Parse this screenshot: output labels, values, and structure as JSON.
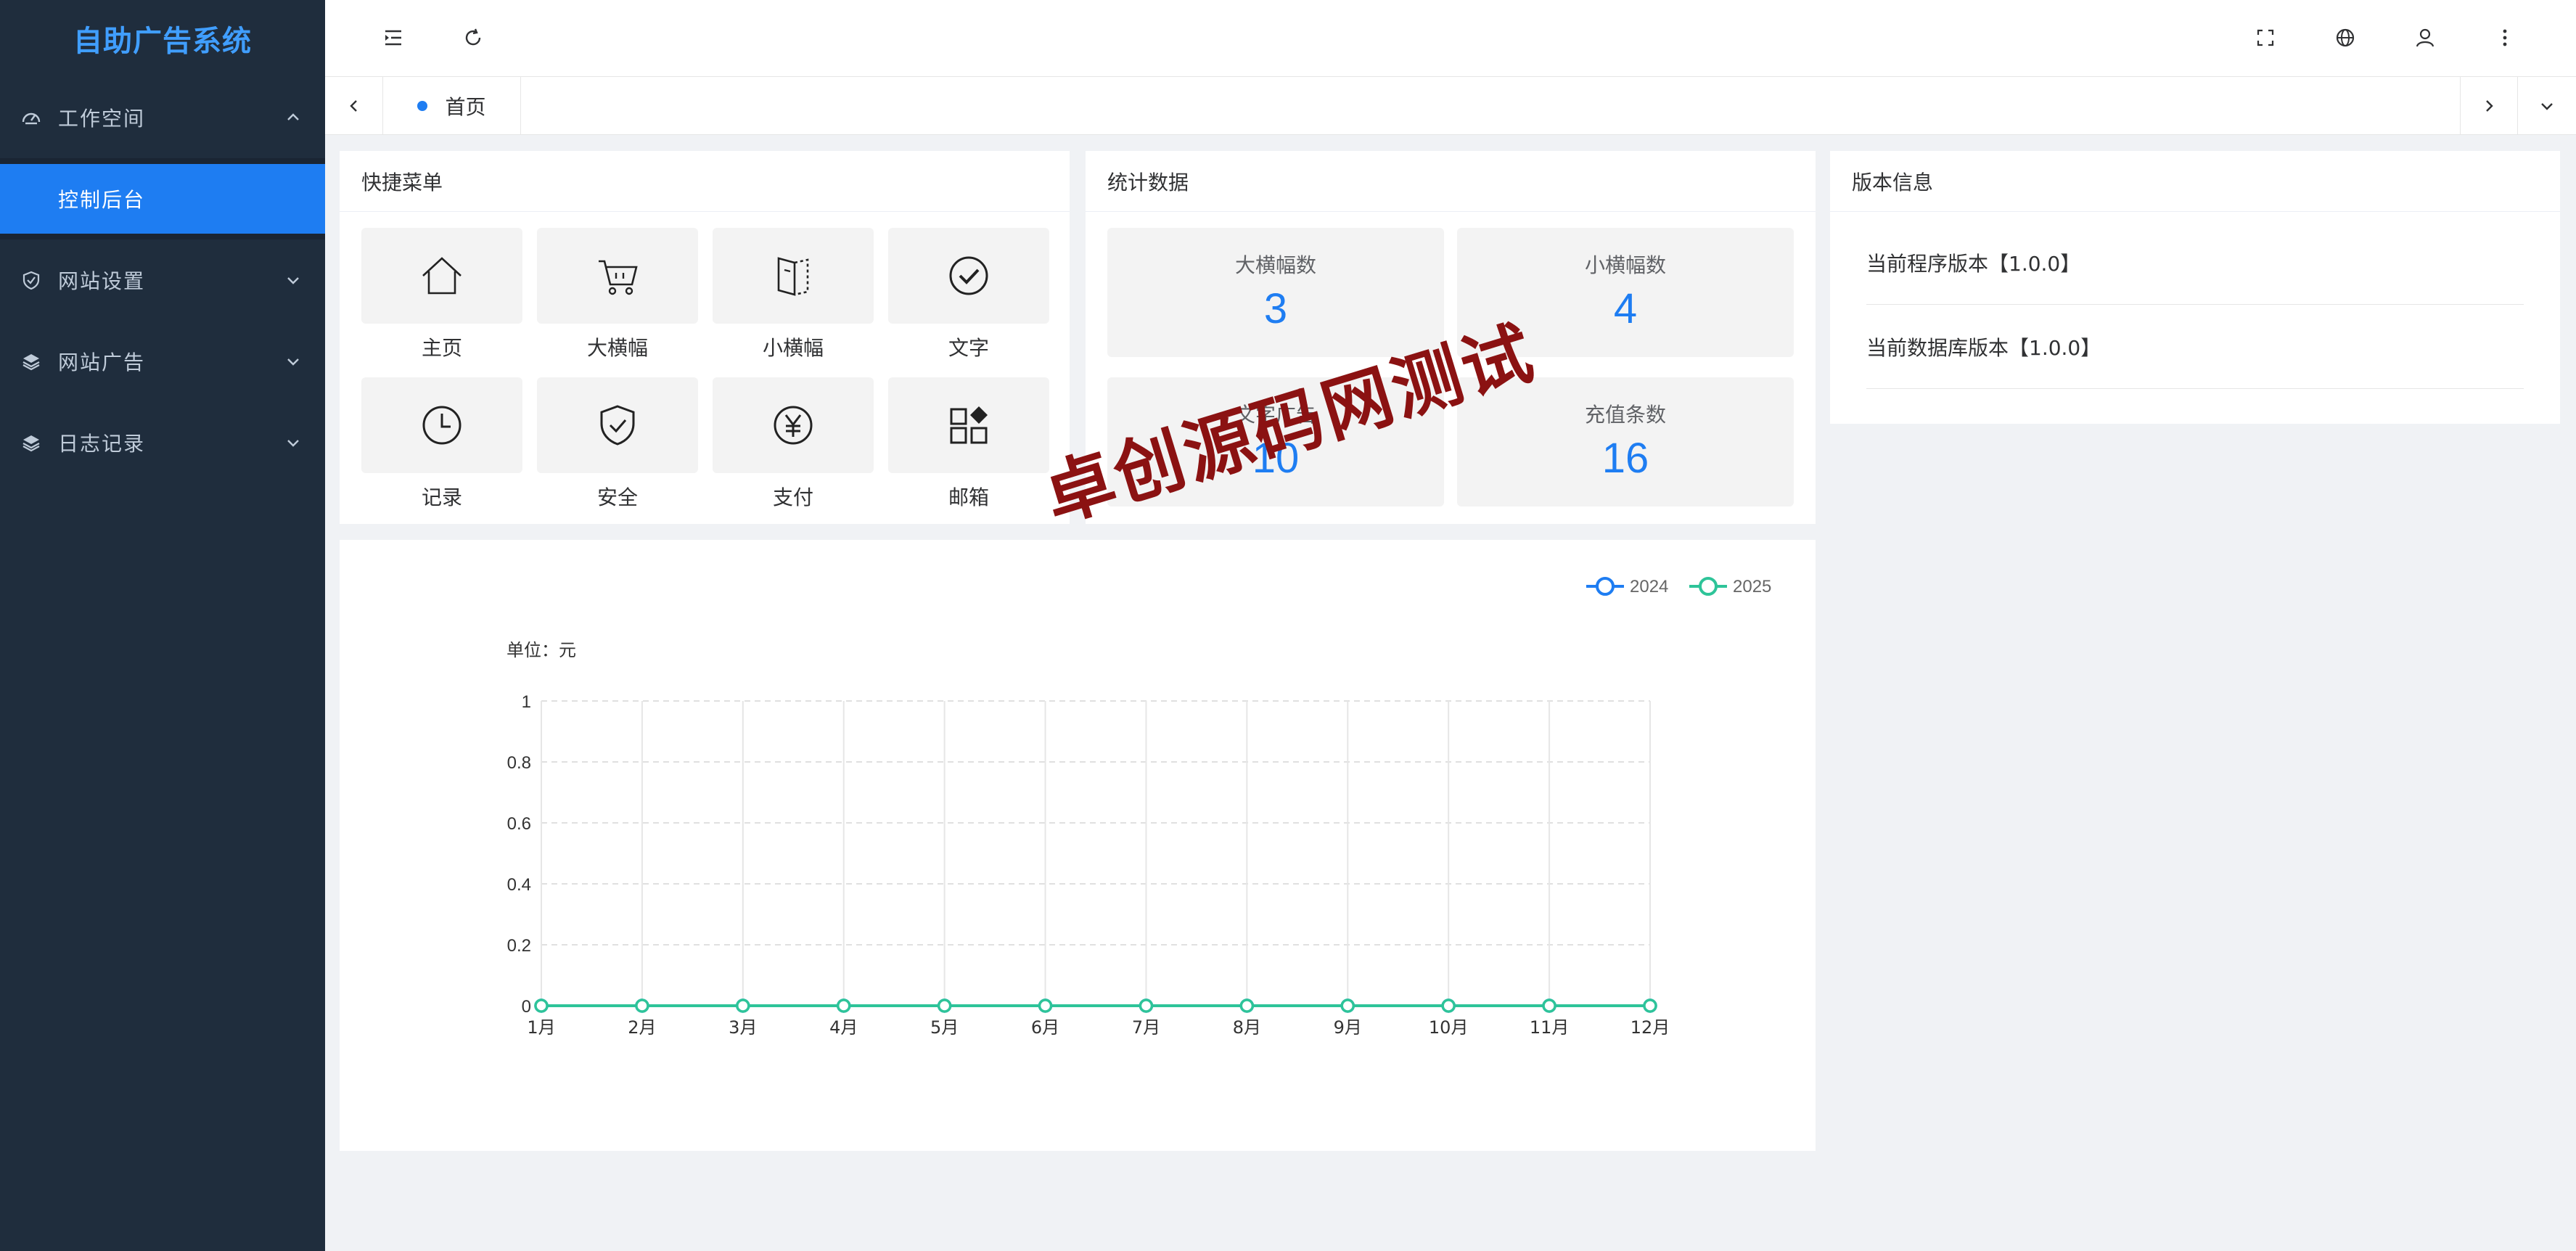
{
  "app": {
    "title": "自助广告系统"
  },
  "sidebar": {
    "groups": [
      {
        "label": "工作空间",
        "icon": "dashboard-icon",
        "expanded": true,
        "children": [
          {
            "label": "控制后台",
            "active": true
          }
        ]
      },
      {
        "label": "网站设置",
        "icon": "shield-check-icon",
        "expanded": false
      },
      {
        "label": "网站广告",
        "icon": "layers-icon",
        "expanded": false
      },
      {
        "label": "日志记录",
        "icon": "layers-icon",
        "expanded": false
      }
    ]
  },
  "header": {
    "icons": [
      "menu-fold-icon",
      "refresh-icon",
      "fullscreen-icon",
      "globe-icon",
      "user-icon",
      "more-vertical-icon"
    ]
  },
  "tabs": [
    {
      "label": "首页",
      "active": true
    }
  ],
  "quick_menu": {
    "title": "快捷菜单",
    "items": [
      {
        "label": "主页",
        "icon": "home-icon"
      },
      {
        "label": "大横幅",
        "icon": "cart-icon"
      },
      {
        "label": "小横幅",
        "icon": "book-icon"
      },
      {
        "label": "文字",
        "icon": "check-circle-icon"
      },
      {
        "label": "记录",
        "icon": "clock-icon"
      },
      {
        "label": "安全",
        "icon": "shield-icon"
      },
      {
        "label": "支付",
        "icon": "yen-icon"
      },
      {
        "label": "邮箱",
        "icon": "apps-icon"
      }
    ]
  },
  "stats": {
    "title": "统计数据",
    "items": [
      {
        "label": "大横幅数",
        "value": "3"
      },
      {
        "label": "小横幅数",
        "value": "4"
      },
      {
        "label": "文字广告",
        "value": "10"
      },
      {
        "label": "充值条数",
        "value": "16"
      }
    ]
  },
  "version": {
    "title": "版本信息",
    "rows": [
      "当前程序版本【1.0.0】",
      "当前数据库版本【1.0.0】"
    ]
  },
  "watermark": "卓创源码网测试",
  "colors": {
    "accent": "#1e7df2",
    "sidebar_bg": "#1f2d3d",
    "series_2024": "#1e7df2",
    "series_2025": "#2ec499",
    "watermark": "#8b1212"
  },
  "chart_data": {
    "type": "line",
    "title": "",
    "ylabel": "单位：元",
    "categories": [
      "1月",
      "2月",
      "3月",
      "4月",
      "5月",
      "6月",
      "7月",
      "8月",
      "9月",
      "10月",
      "11月",
      "12月"
    ],
    "series": [
      {
        "name": "2024",
        "values": [
          0,
          0,
          0,
          0,
          0,
          0,
          0,
          0,
          0,
          0,
          0,
          0
        ]
      },
      {
        "name": "2025",
        "values": [
          0,
          0,
          0,
          0,
          0,
          0,
          0,
          0,
          0,
          0,
          0,
          0
        ]
      }
    ],
    "ylim": [
      0,
      1
    ],
    "yticks": [
      "0",
      "0.2",
      "0.4",
      "0.6",
      "0.8",
      "1"
    ],
    "grid": true,
    "legend": "top-right"
  }
}
